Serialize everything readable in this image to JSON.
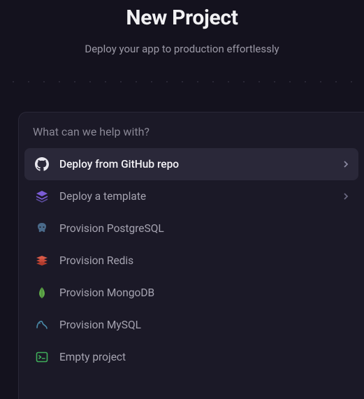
{
  "header": {
    "title": "New Project",
    "subtitle": "Deploy your app to production effortlessly"
  },
  "search": {
    "placeholder": "What can we help with?",
    "value": ""
  },
  "options": [
    {
      "icon": "github-icon",
      "label": "Deploy from GitHub repo",
      "active": true,
      "chevron": true
    },
    {
      "icon": "template-icon",
      "label": "Deploy a template",
      "active": false,
      "chevron": true
    },
    {
      "icon": "postgres-icon",
      "label": "Provision PostgreSQL",
      "active": false,
      "chevron": false
    },
    {
      "icon": "redis-icon",
      "label": "Provision Redis",
      "active": false,
      "chevron": false
    },
    {
      "icon": "mongodb-icon",
      "label": "Provision MongoDB",
      "active": false,
      "chevron": false
    },
    {
      "icon": "mysql-icon",
      "label": "Provision MySQL",
      "active": false,
      "chevron": false
    },
    {
      "icon": "terminal-icon",
      "label": "Empty project",
      "active": false,
      "chevron": false
    }
  ],
  "colors": {
    "bg": "#14121e",
    "panel": "#1b1927",
    "active": "#2a2839",
    "text_muted": "#a5a3b0",
    "text_bright": "#f4f3f7",
    "purple": "#7b5cd6",
    "postgres": "#4a6a8a",
    "redis": "#c94b3a",
    "mongo": "#5fa849",
    "mysql": "#4a8aa8",
    "terminal": "#3fae5a"
  }
}
